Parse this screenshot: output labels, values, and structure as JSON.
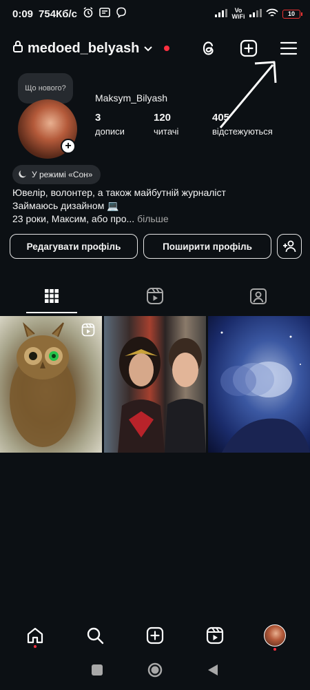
{
  "status": {
    "time": "0:09",
    "speed": "754Кб/с",
    "carrier": "Vo WiFi",
    "battery": "10"
  },
  "header": {
    "username": "medoed_belyash"
  },
  "profile": {
    "note": "Що нового?",
    "full_name": "Maksym_Bilyash",
    "stats": [
      {
        "value": "3",
        "label": "дописи"
      },
      {
        "value": "120",
        "label": "читачі"
      },
      {
        "value": "405",
        "label": "відстежуються"
      }
    ],
    "sleep_mode": "У режимі «Сон»",
    "bio": {
      "line1": "Ювелір, волонтер, а також майбутній журналіст",
      "line2": "Займаюсь дизайном 💻",
      "line3": "23 роки, Максим, або про...",
      "more": " більше"
    }
  },
  "buttons": {
    "edit": "Редагувати профіль",
    "share": "Поширити профіль"
  },
  "tabs": [
    "posts",
    "reels",
    "tagged"
  ],
  "posts": [
    {
      "subject": "owl figurine",
      "is_reel": true
    },
    {
      "subject": "two people photo",
      "is_reel": false
    },
    {
      "subject": "space portrait",
      "is_reel": false
    }
  ],
  "colors": {
    "background": "#0c1014",
    "notification": "#ff3040",
    "chip": "#262a2f"
  }
}
